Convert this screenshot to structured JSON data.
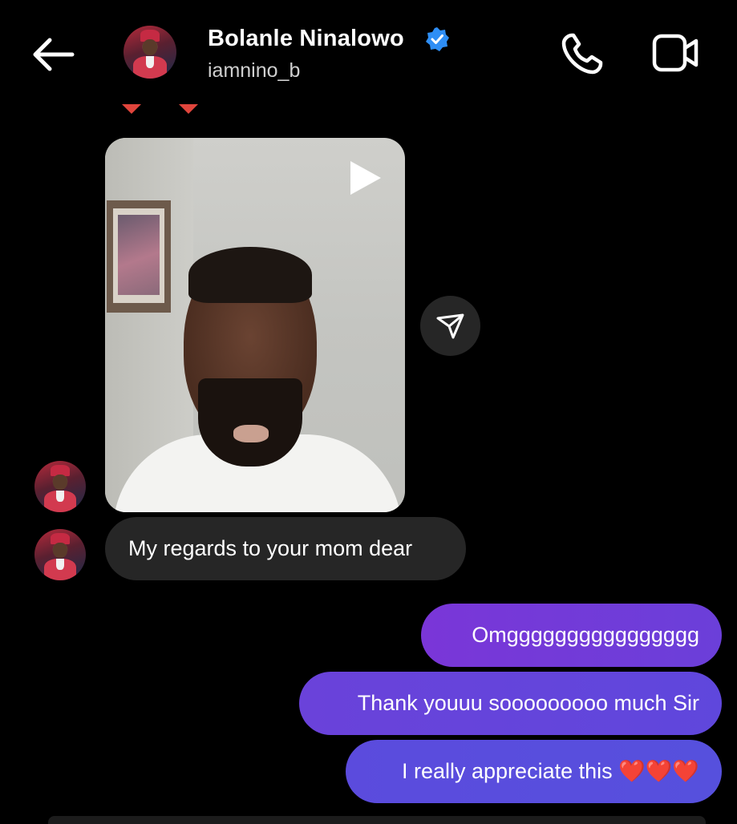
{
  "header": {
    "name": "Bolanle Ninalowo",
    "handle": "iamnino_b",
    "verified": true
  },
  "icons": {
    "back": "arrow-left-icon",
    "phone": "phone-icon",
    "video": "video-camera-icon",
    "play": "play-icon",
    "share": "paper-plane-icon",
    "verified": "verified-badge-icon"
  },
  "colors": {
    "background": "#000000",
    "incoming_bubble": "#262626",
    "outgoing_bubble": "#6a3fd9",
    "verified": "#2e8ef5"
  },
  "messages": {
    "incoming": [
      {
        "type": "video"
      },
      {
        "type": "text",
        "text": "My regards to your mom dear"
      }
    ],
    "outgoing": [
      {
        "text": "Omgggggggggggggggg"
      },
      {
        "text": "Thank youuu sooooooooo much Sir"
      },
      {
        "text": "I really appreciate this",
        "emoji": "❤️❤️❤️"
      }
    ]
  }
}
